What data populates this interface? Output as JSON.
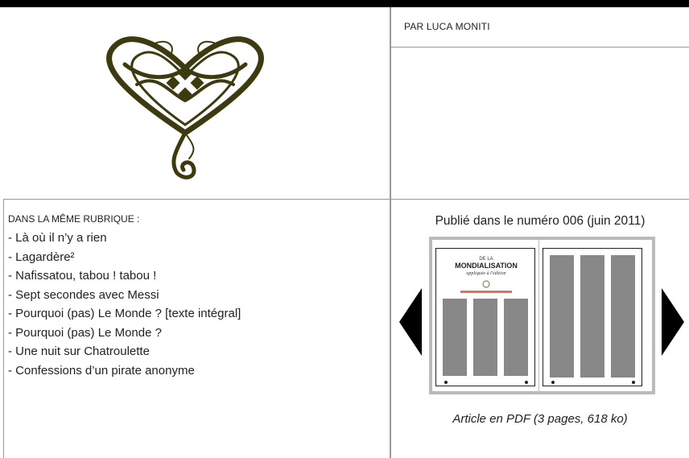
{
  "author": {
    "label": "PAR LUCA MONITI"
  },
  "rubric": {
    "title": "DANS LA MÊME RUBRIQUE :",
    "items": [
      "- Là où il n’y a rien",
      "- Lagardère²",
      "- Nafissatou, tabou ! tabou !",
      "- Sept secondes avec Messi",
      "- Pourquoi (pas) Le Monde ? [texte intégral]",
      "- Pourquoi (pas) Le Monde ?",
      "- Une nuit sur Chatroulette",
      "- Confessions d’un pirate anonyme"
    ]
  },
  "publication": {
    "text": "Publié dans le numéro 006 (juin 2011)",
    "page_heading_1": "DE LA",
    "page_heading_2": "MONDIALISATION",
    "page_heading_3": "appliquée à l'édition"
  },
  "pdf": {
    "label": "Article en PDF (3 pages, 618 ko)"
  },
  "colors": {
    "ornament": "#3d3a10",
    "accent_red": "#e07060",
    "border": "#999999"
  }
}
